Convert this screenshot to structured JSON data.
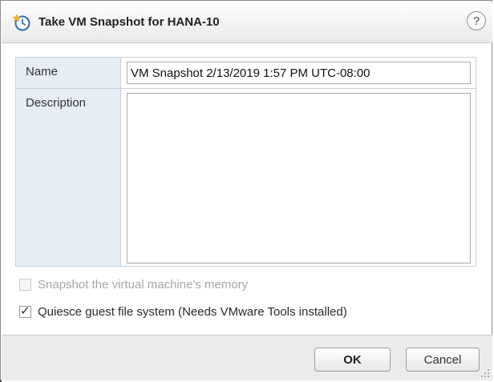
{
  "dialog": {
    "title": "Take VM Snapshot for HANA-10",
    "help_glyph": "?",
    "icon": "snapshot-clock-icon"
  },
  "form": {
    "name_label": "Name",
    "name_value": "VM Snapshot 2/13/2019 1:57 PM UTC-08:00",
    "description_label": "Description",
    "description_value": ""
  },
  "options": {
    "memory_label": "Snapshot the virtual machine's memory",
    "memory_checked": false,
    "memory_enabled": false,
    "quiesce_label": "Quiesce guest file system (Needs VMware Tools installed)",
    "quiesce_checked": true
  },
  "footer": {
    "ok_label": "OK",
    "cancel_label": "Cancel"
  },
  "colors": {
    "label_column_bg": "#e6edf5",
    "disabled_text": "#a6a6a6"
  }
}
